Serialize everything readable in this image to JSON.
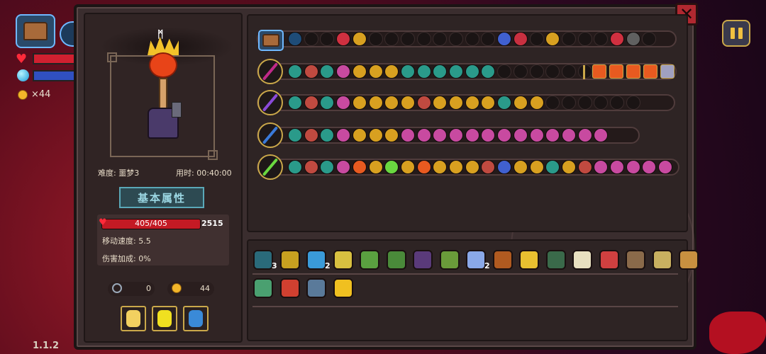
{
  "hud": {
    "coins": "×44",
    "version": "1.1.2"
  },
  "close_glyph": "✕",
  "character": {
    "difficulty": "难度: 噩梦3",
    "time_label": "用时: 00:40:00",
    "section_title": "基本属性",
    "hp_text": "405/405",
    "shield_value": "2515",
    "move_speed": "移动速度: 5.5",
    "damage_bonus": "伤害加成: 0%",
    "keys": "0",
    "coins": "44"
  },
  "equip_slots": [
    {
      "icon": "golden-potion-icon",
      "color": "#f2d060"
    },
    {
      "icon": "yellow-potion-icon",
      "color": "#f0e020"
    },
    {
      "icon": "blue-potion-icon",
      "color": "#3a8ad8"
    }
  ],
  "weapon_rows": [
    {
      "head": "chest-icon",
      "staff_color": "",
      "chips": [
        "#1e4c78",
        "e",
        "e",
        "#d03040",
        "#d8a020",
        "e",
        "e",
        "e",
        "e",
        "e",
        "e",
        "e",
        "e",
        "#4060d0",
        "#c83040",
        "e",
        "#d8a020",
        "e",
        "e",
        "e",
        "#d03040",
        "#606060",
        "e"
      ]
    },
    {
      "head": "staff-icon",
      "staff_color": "#c02a8a",
      "chips": [
        "#2a9a8a",
        "#c04a40",
        "#2a9a8a",
        "#c84aa0",
        "#d8a020",
        "#d8a020",
        "#d8a020",
        "#2a9a8a",
        "#2a9a8a",
        "#2a9a8a",
        "#2a9a8a",
        "#2a9a8a",
        "#2a9a8a",
        "e",
        "e",
        "e",
        "e",
        "e",
        "e"
      ],
      "tail": [
        "#e85a20",
        "#e85a20",
        "#e85a20",
        "#e85a20",
        "#a0a0c0"
      ]
    },
    {
      "head": "staff-icon",
      "staff_color": "#8a4ad8",
      "chips": [
        "#2a9a8a",
        "#c04a40",
        "#2a9a8a",
        "#c84aa0",
        "#d8a020",
        "#d8a020",
        "#d8a020",
        "#d8a020",
        "#c04a40",
        "#d8a020",
        "#d8a020",
        "#d8a020",
        "#d8a020",
        "#2a9a8a",
        "#d8a020",
        "#d8a020",
        "e",
        "e",
        "e",
        "e",
        "e",
        "e"
      ]
    },
    {
      "head": "staff-icon",
      "staff_color": "#3a7ad8",
      "chips": [
        "#2a9a8a",
        "#c04a40",
        "#2a9a8a",
        "#c84aa0",
        "#d8a020",
        "#d8a020",
        "#d8a020",
        "#c84aa0",
        "#c84aa0",
        "#c84aa0",
        "#c84aa0",
        "#c84aa0",
        "#c84aa0",
        "#c84aa0",
        "#c84aa0",
        "#c84aa0",
        "#c84aa0",
        "#c84aa0",
        "#c84aa0",
        "#c84aa0"
      ]
    },
    {
      "head": "staff-icon",
      "staff_color": "#6ad840",
      "chips": [
        "#2a9a8a",
        "#c04a40",
        "#2a9a8a",
        "#c84aa0",
        "#e85a20",
        "#d8a020",
        "#6ad840",
        "#d8a020",
        "#e85a20",
        "#d8a020",
        "#d8a020",
        "#d8a020",
        "#c04a40",
        "#4060d0",
        "#d8a020",
        "#d8a020",
        "#2a9a8a",
        "#d8a020",
        "#c04a40",
        "#c84aa0",
        "#c84aa0",
        "#c84aa0",
        "#c84aa0",
        "#c84aa0"
      ]
    }
  ],
  "items": [
    {
      "color": "#2a6a7a",
      "count": "3"
    },
    {
      "color": "#c8a020",
      "count": ""
    },
    {
      "color": "#3a9ad8",
      "count": "2"
    },
    {
      "color": "#d8c040",
      "count": ""
    },
    {
      "color": "#5aa040",
      "count": ""
    },
    {
      "color": "#4a8a3a",
      "count": ""
    },
    {
      "color": "#5a3a7a",
      "count": ""
    },
    {
      "color": "#6a9a3a",
      "count": ""
    },
    {
      "color": "#8aa8e8",
      "count": "2"
    },
    {
      "color": "#b05a20",
      "count": ""
    },
    {
      "color": "#e8c030",
      "count": ""
    },
    {
      "color": "#3a6a4a",
      "count": ""
    },
    {
      "color": "#e8e0c0",
      "count": ""
    },
    {
      "color": "#d04040",
      "count": ""
    },
    {
      "color": "#8a6a4a",
      "count": ""
    },
    {
      "color": "#c8b060",
      "count": ""
    },
    {
      "color": "#c89040",
      "count": ""
    },
    {
      "color": "#4aa070",
      "count": ""
    },
    {
      "color": "#d04030",
      "count": ""
    },
    {
      "color": "#5a7a9a",
      "count": ""
    },
    {
      "color": "#f0c020",
      "count": ""
    }
  ]
}
